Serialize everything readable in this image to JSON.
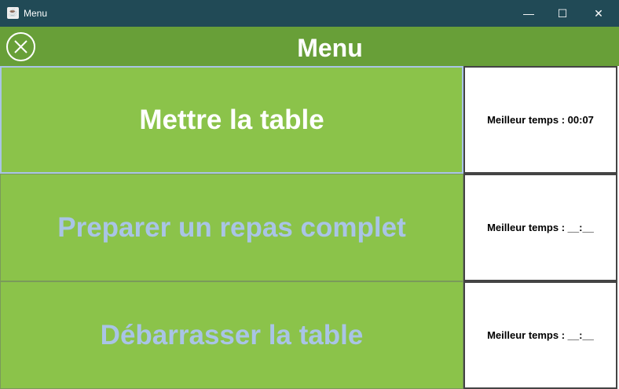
{
  "window": {
    "title": "Menu",
    "minimize": "—",
    "maximize": "☐",
    "close": "✕"
  },
  "header": {
    "title": "Menu",
    "close_icon": "circle-x-icon"
  },
  "items": [
    {
      "label": "Mettre la table",
      "best": "Meilleur temps : 00:07"
    },
    {
      "label": "Preparer un repas complet",
      "best": "Meilleur temps : __:__"
    },
    {
      "label": "Débarrasser la table",
      "best": "Meilleur temps : __:__"
    }
  ]
}
